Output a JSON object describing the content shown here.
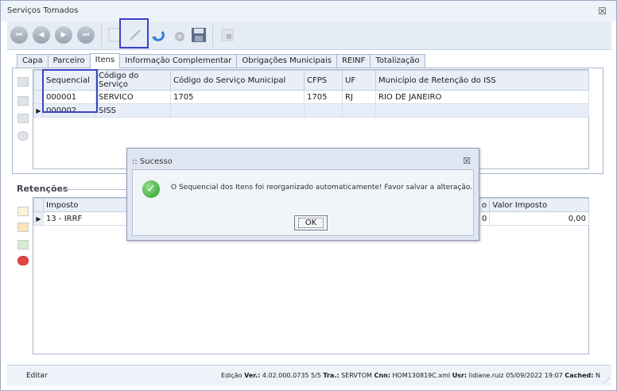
{
  "window": {
    "title": "Serviços Tomados",
    "close": "☒"
  },
  "toolbar": {
    "buttons": [
      {
        "name": "first-record",
        "glyph": "⏮"
      },
      {
        "name": "previous-record",
        "glyph": "◀"
      },
      {
        "name": "next-record",
        "glyph": "▶"
      },
      {
        "name": "last-record",
        "glyph": "⏭"
      }
    ]
  },
  "tabs": [
    "Capa",
    "Parceiro",
    "Itens",
    "Informação Complementar",
    "Obrigações Municipais",
    "REINF",
    "Totalização"
  ],
  "active_tab": "Itens",
  "items_table": {
    "columns": [
      "Sequencial",
      "Código do Serviço",
      "Código do Serviço Municipal",
      "CFPS",
      "UF",
      "Município de Retenção do ISS"
    ],
    "rows": [
      [
        "000001",
        "SERVICO",
        "1705",
        "1705",
        "RJ",
        "RIO DE JANEIRO"
      ],
      [
        "000002",
        "SISS",
        "",
        "",
        "",
        ""
      ]
    ]
  },
  "retencoes": {
    "label": "Retenções",
    "columns": [
      "Imposto",
      "Valor Imposto"
    ],
    "partial_col": "o",
    "rows": [
      {
        "imposto": "13 - IRRF",
        "partial": "0",
        "valor": "0,00"
      }
    ]
  },
  "status": {
    "left": "Editar",
    "edicao": "Edição",
    "ver_label": "Ver.:",
    "ver": "4.02.000.0735 5/5",
    "tra_label": "Tra.:",
    "tra": "SERVTOM",
    "cnn_label": "Cnn:",
    "cnn": "HOM130819C.xml",
    "usr_label": "Usr:",
    "usr": "lidiane.ruiz 05/09/2022 19:07",
    "cached_label": "Cached:",
    "cached": "N"
  },
  "dialog": {
    "title": ":: Sucesso",
    "close": "☒",
    "message": "O Sequencial dos Itens foi reorganizado automaticamente! Favor salvar a alteração.",
    "ok": "OK"
  },
  "colors": {
    "highlight": "#3a42c7",
    "accent": "#2d9a2a"
  }
}
